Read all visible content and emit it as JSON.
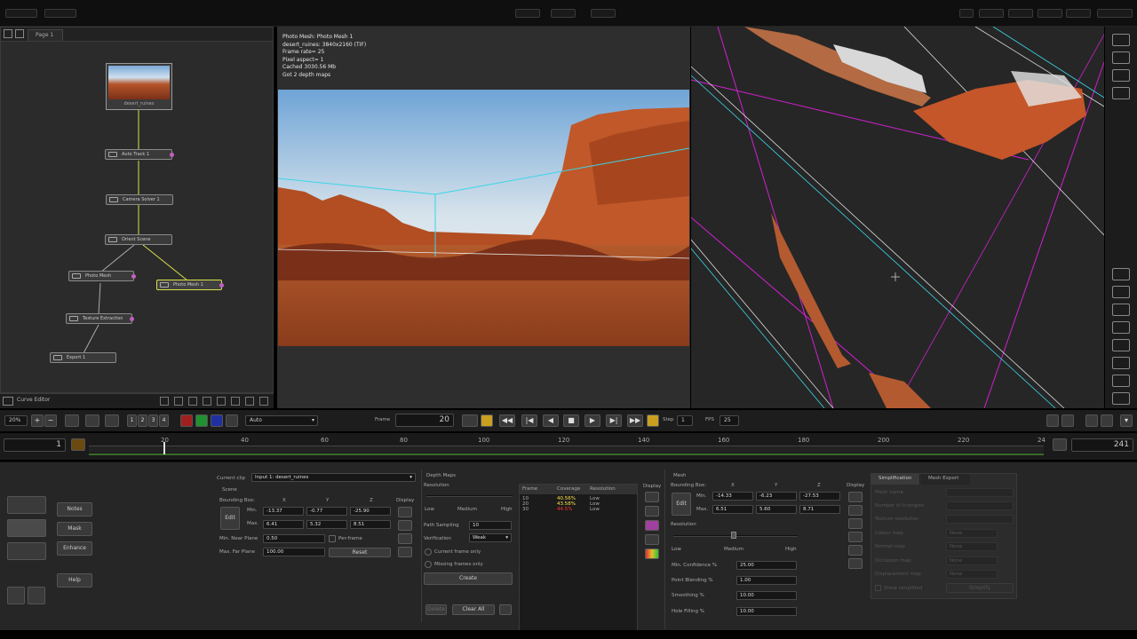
{
  "page_tab": "Page 1",
  "nodes": {
    "desert": "desert_ruines",
    "autotrack": "Auto Track 1",
    "camsolver": "Camera Solver 1",
    "orient": "Orient Scene",
    "photomesh": "Photo Mesh",
    "photomesh1": "Photo Mesh 1",
    "texture": "Texture Extraction",
    "export": "Export 1"
  },
  "curve_editor": "Curve Editor",
  "viewer_info": [
    "Photo Mesh: Photo Mesh 1",
    "desert_ruines: 3840x2160 (TIF)",
    "Frame rate= 25",
    "Pixel aspect= 1",
    "Cached 3030.56 Mb",
    "Got 2 depth maps"
  ],
  "transport": {
    "zoom": "20%",
    "numbtns": [
      "1",
      "2",
      "3",
      "4"
    ],
    "mode": "Auto",
    "frame_label": "Frame",
    "frame": "20",
    "step_label": "Step",
    "step": "1",
    "fps_label": "FPS",
    "fps": "25"
  },
  "timeline": {
    "start": "1",
    "end": "241",
    "ticks": [
      "20",
      "40",
      "60",
      "80",
      "100",
      "120",
      "140",
      "160",
      "180",
      "200",
      "220",
      "24"
    ]
  },
  "left_buttons": {
    "notes": "Notes",
    "mask": "Mask",
    "enhance": "Enhance",
    "help": "Help"
  },
  "scene": {
    "current_clip_label": "Current clip",
    "current_clip": "Input 1: desert_ruines",
    "scene_label": "Scene",
    "bbox_label": "Bounding Box:",
    "x": "X",
    "y": "Y",
    "z": "Z",
    "display": "Display",
    "edit": "Edit",
    "min_label": "Min.",
    "max_label": "Max.",
    "min": [
      "-13.37",
      "-0.77",
      "-25.90"
    ],
    "max": [
      "6.41",
      "5.32",
      "8.51"
    ],
    "near_label": "Min. Near Plane",
    "near": "0.50",
    "perframe": "Per-frame",
    "far_label": "Max. Far Plane",
    "far": "100.00",
    "reset": "Reset"
  },
  "depth": {
    "title": "Depth Maps",
    "resolution": "Resolution",
    "low": "Low",
    "medium": "Medium",
    "high": "High",
    "path_label": "Path Sampling",
    "path": "10",
    "verif_label": "Verification",
    "verif": "Weak",
    "current_only": "Current frame only",
    "missing_only": "Missing frames only",
    "create": "Create",
    "delete": "Delete",
    "clear": "Clear All",
    "table_headers": [
      "Frame",
      "Coverage",
      "Resolution"
    ],
    "rows": [
      {
        "frame": "10",
        "coverage": "40.56%",
        "res": "Low",
        "color": "#ffe14a"
      },
      {
        "frame": "20",
        "coverage": "43.58%",
        "res": "Low",
        "color": "#ffe14a"
      },
      {
        "frame": "30",
        "coverage": "44.5%",
        "res": "Low",
        "color": "#ff3030"
      }
    ],
    "display": "Display"
  },
  "mesh": {
    "title": "Mesh",
    "bbox_label": "Bounding Box:",
    "x": "X",
    "y": "Y",
    "z": "Z",
    "display": "Display",
    "edit": "Edit",
    "min_label": "Min.",
    "max_label": "Max.",
    "min": [
      "-14.33",
      "-6.23",
      "-27.53"
    ],
    "max": [
      "6.51",
      "5.60",
      "8.71"
    ],
    "resolution": "Resolution",
    "low": "Low",
    "medium": "Medium",
    "high": "High",
    "conf_label": "Min. Confidence %",
    "conf": "25.00",
    "blend_label": "Point Blending %",
    "blend": "1.00",
    "smooth_label": "Smoothing %",
    "smooth": "10.00",
    "fill_label": "Hole Filling %",
    "fill": "10.00"
  },
  "simplification": {
    "tab1": "Simplification",
    "tab2": "Mesh Export",
    "rows": [
      "Mesh name",
      "Number of triangles",
      "Texture resolution",
      "Colour map",
      "Normal map",
      "Occlusion map",
      "Displacement map"
    ],
    "none": "None",
    "show": "Show simplified",
    "simplify": "Simplify"
  }
}
